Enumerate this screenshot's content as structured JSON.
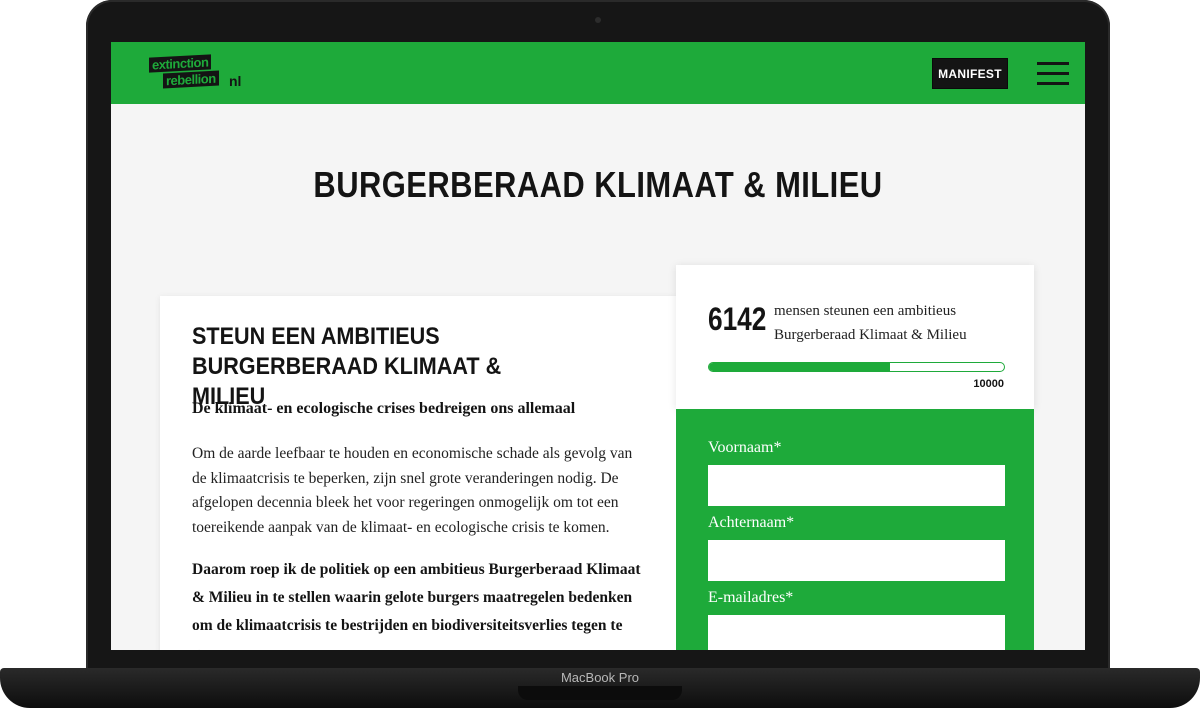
{
  "device": {
    "brand_label": "MacBook Pro"
  },
  "header": {
    "logo": {
      "line1": "extinction",
      "line2": "rebellion",
      "suffix": "nl"
    },
    "manifest_label": "MANIFEST",
    "menu_icon": "hamburger-menu-icon"
  },
  "page": {
    "title": "BURGERBERAAD KLIMAAT & MILIEU"
  },
  "article": {
    "heading": "STEUN EEN AMBITIEUS BURGERBERAAD KLIMAAT & MILIEU",
    "subheading": "De klimaat- en ecologische crises bedreigen ons allemaal",
    "body": "Om de aarde leefbaar te houden en economische schade als gevolg van de klimaatcrisis te beperken, zijn snel grote veranderingen nodig. De afgelopen decennia bleek het voor regeringen onmogelijk om tot een toereikende aanpak van de klimaat- en ecologische crisis te komen.",
    "call_to_action": "Daarom roep ik de politiek op een ambitieus Burgerberaad Klimaat & Milieu in te stellen waarin gelote burgers maatregelen bedenken om de klimaatcrisis te bestrijden en biodiversiteitsverlies tegen te gaan."
  },
  "signup": {
    "count": "6142",
    "count_text": "mensen steunen een ambitieus Burgerberaad Klimaat & Milieu",
    "goal": "10000",
    "progress_fraction": 0.6142,
    "fields": [
      {
        "label": "Voornaam*",
        "value": ""
      },
      {
        "label": "Achternaam*",
        "value": ""
      },
      {
        "label": "E-mailadres*",
        "value": ""
      }
    ]
  },
  "colors": {
    "brand_green": "#1eaa3a",
    "dark": "#141414",
    "background": "#f5f5f5"
  }
}
